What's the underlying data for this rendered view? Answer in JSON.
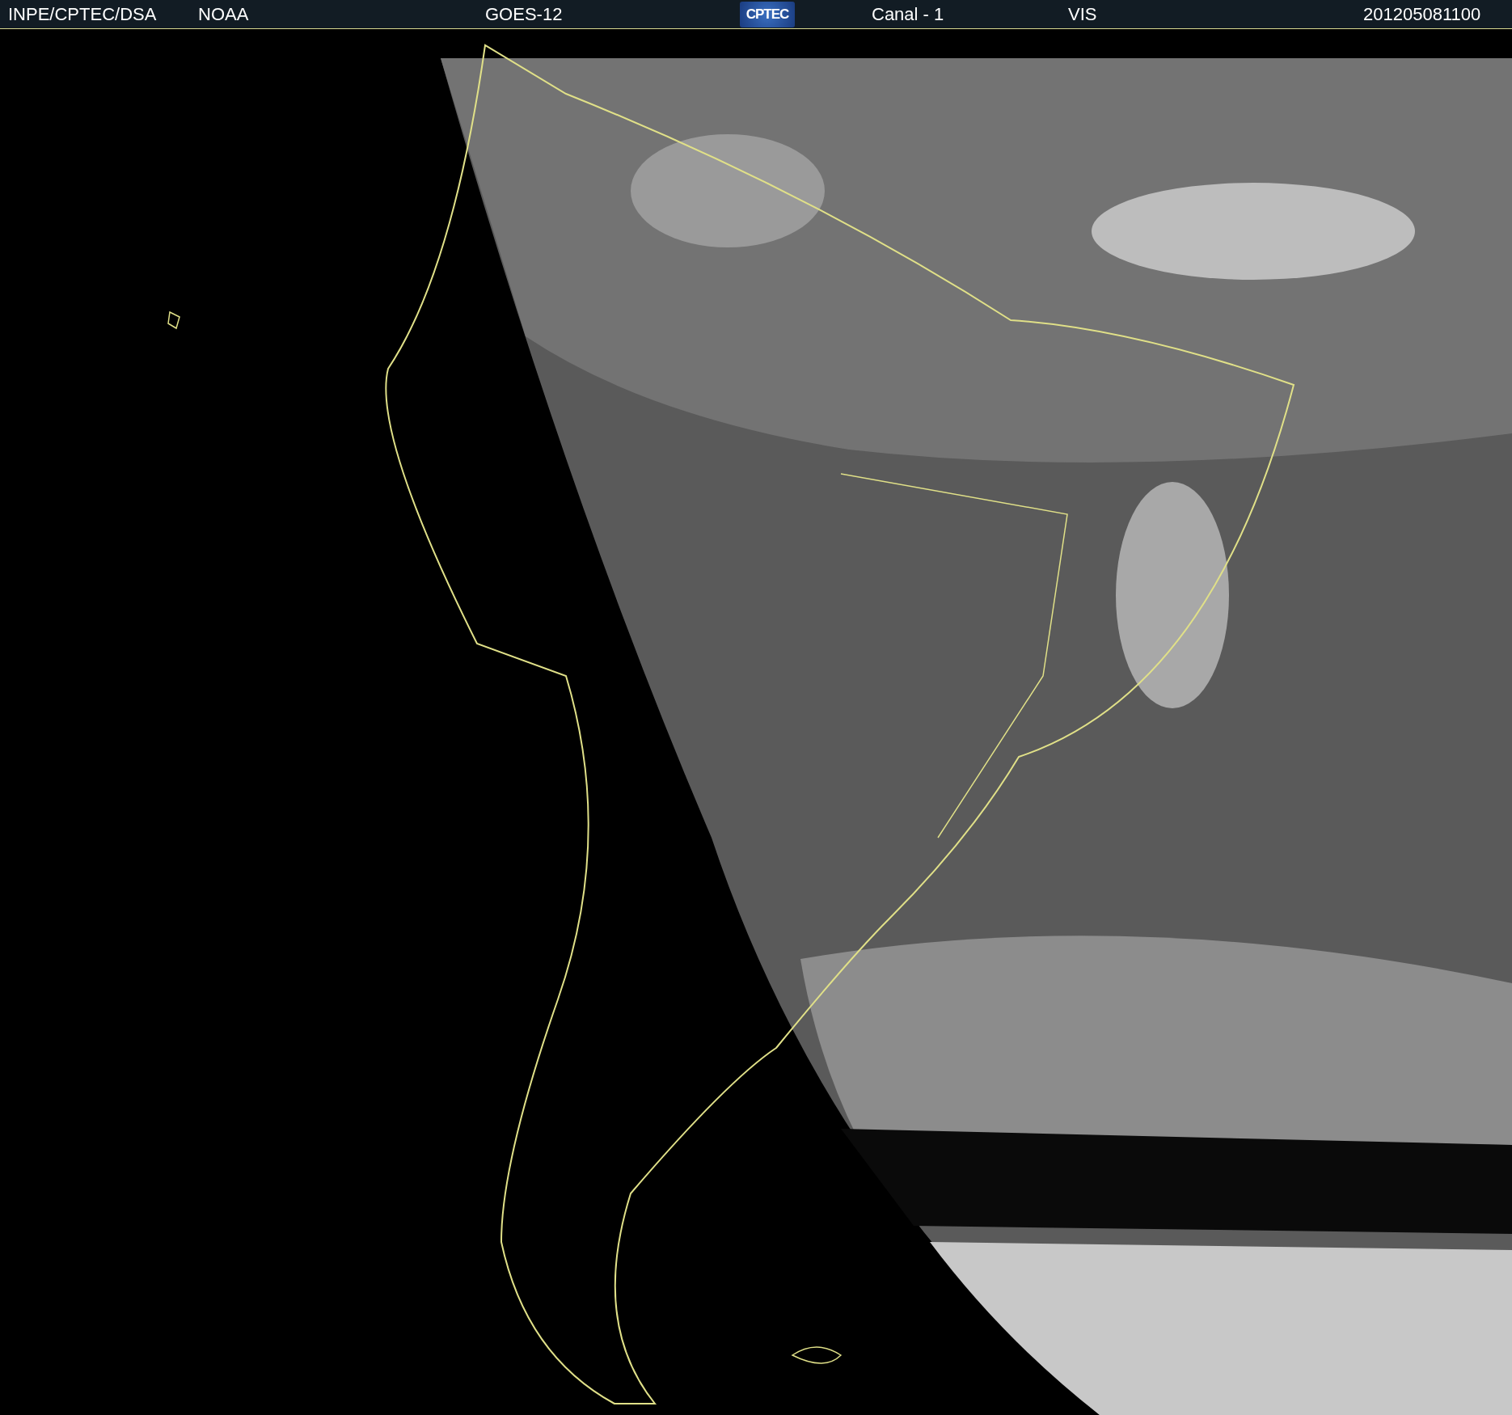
{
  "header": {
    "source": "INPE/CPTEC/DSA",
    "agency": "NOAA",
    "satellite": "GOES-12",
    "logo": "CPTEC",
    "channel": "Canal - 1",
    "band": "VIS",
    "timestamp": "201205081100"
  }
}
